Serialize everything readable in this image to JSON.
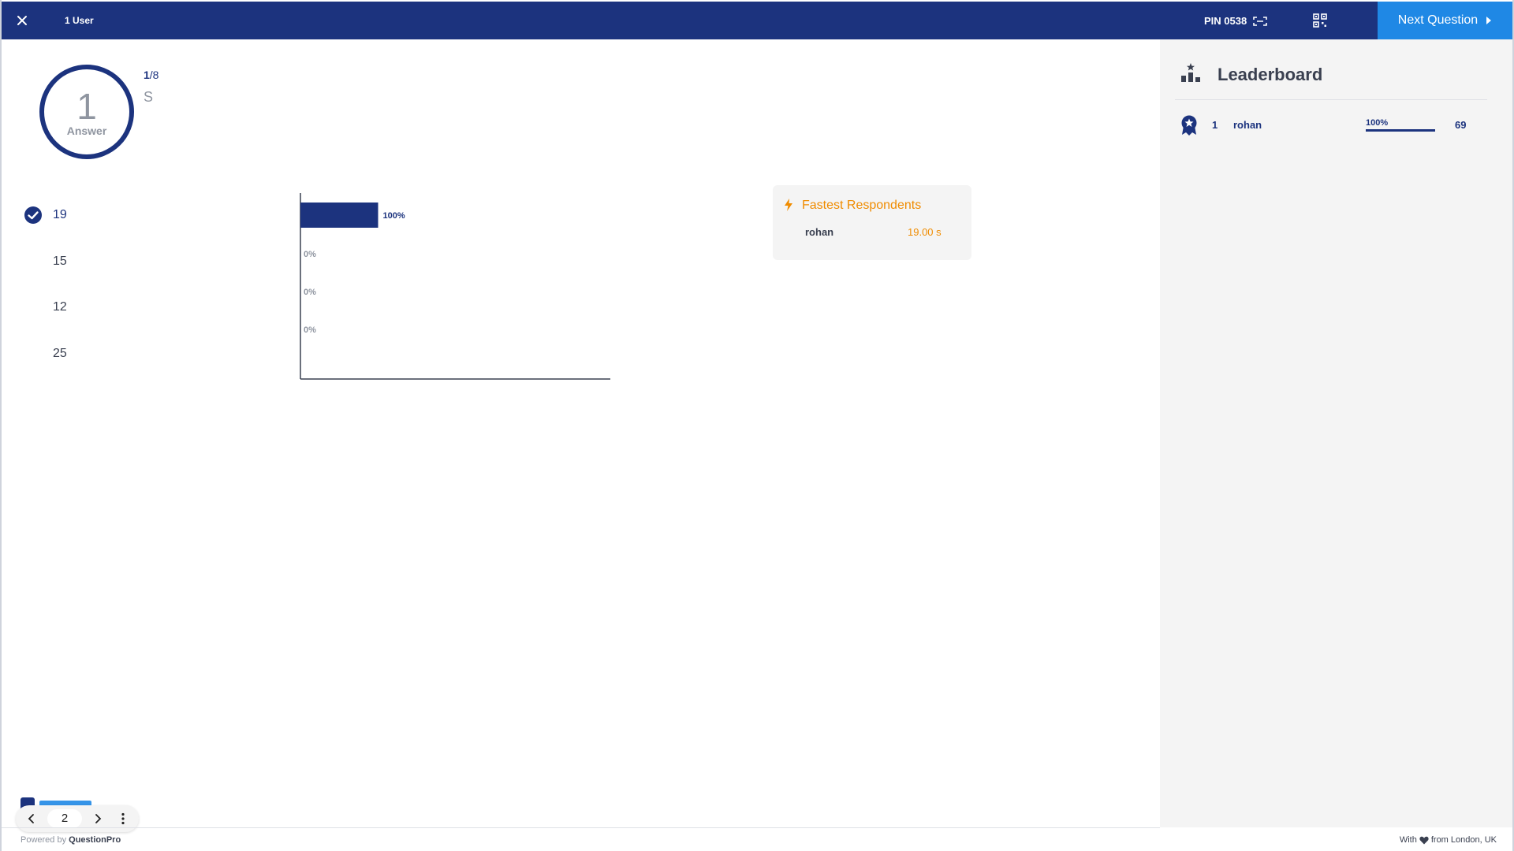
{
  "topbar": {
    "users_label": "1 User",
    "pin_label": "PIN 0538",
    "next_label": "Next Question"
  },
  "question": {
    "answer_count": "1",
    "answer_label": "Answer",
    "current": "1",
    "total": "/8",
    "text": "S"
  },
  "options": [
    {
      "label": "19",
      "correct": true
    },
    {
      "label": "15",
      "correct": false
    },
    {
      "label": "12",
      "correct": false
    },
    {
      "label": "25",
      "correct": false
    }
  ],
  "chart_data": {
    "type": "bar",
    "orientation": "horizontal",
    "categories": [
      "19",
      "15",
      "12",
      "25"
    ],
    "values": [
      100,
      0,
      0,
      0
    ],
    "value_labels": [
      "100%",
      "0%",
      "0%",
      "0%"
    ],
    "xlim": [
      0,
      400
    ],
    "colors": {
      "bar": "#1c337e",
      "axis": "#3a4050",
      "label": "#1c337e",
      "zero_label": "#8f95a0"
    }
  },
  "fastest": {
    "title": "Fastest Respondents",
    "name": "rohan",
    "time": "19.00 s"
  },
  "leaderboard": {
    "title": "Leaderboard",
    "rows": [
      {
        "rank": "1",
        "name": "rohan",
        "percent": "100%",
        "score": "69"
      }
    ]
  },
  "pager": {
    "page": "2"
  },
  "footer": {
    "powered_prefix": "Powered by ",
    "powered_brand": "QuestionPro",
    "love_prefix": "With",
    "love_suffix": "from London, UK"
  },
  "colors": {
    "brand": "#1c337e",
    "accent": "#1f88e5",
    "orange": "#f08c00"
  }
}
